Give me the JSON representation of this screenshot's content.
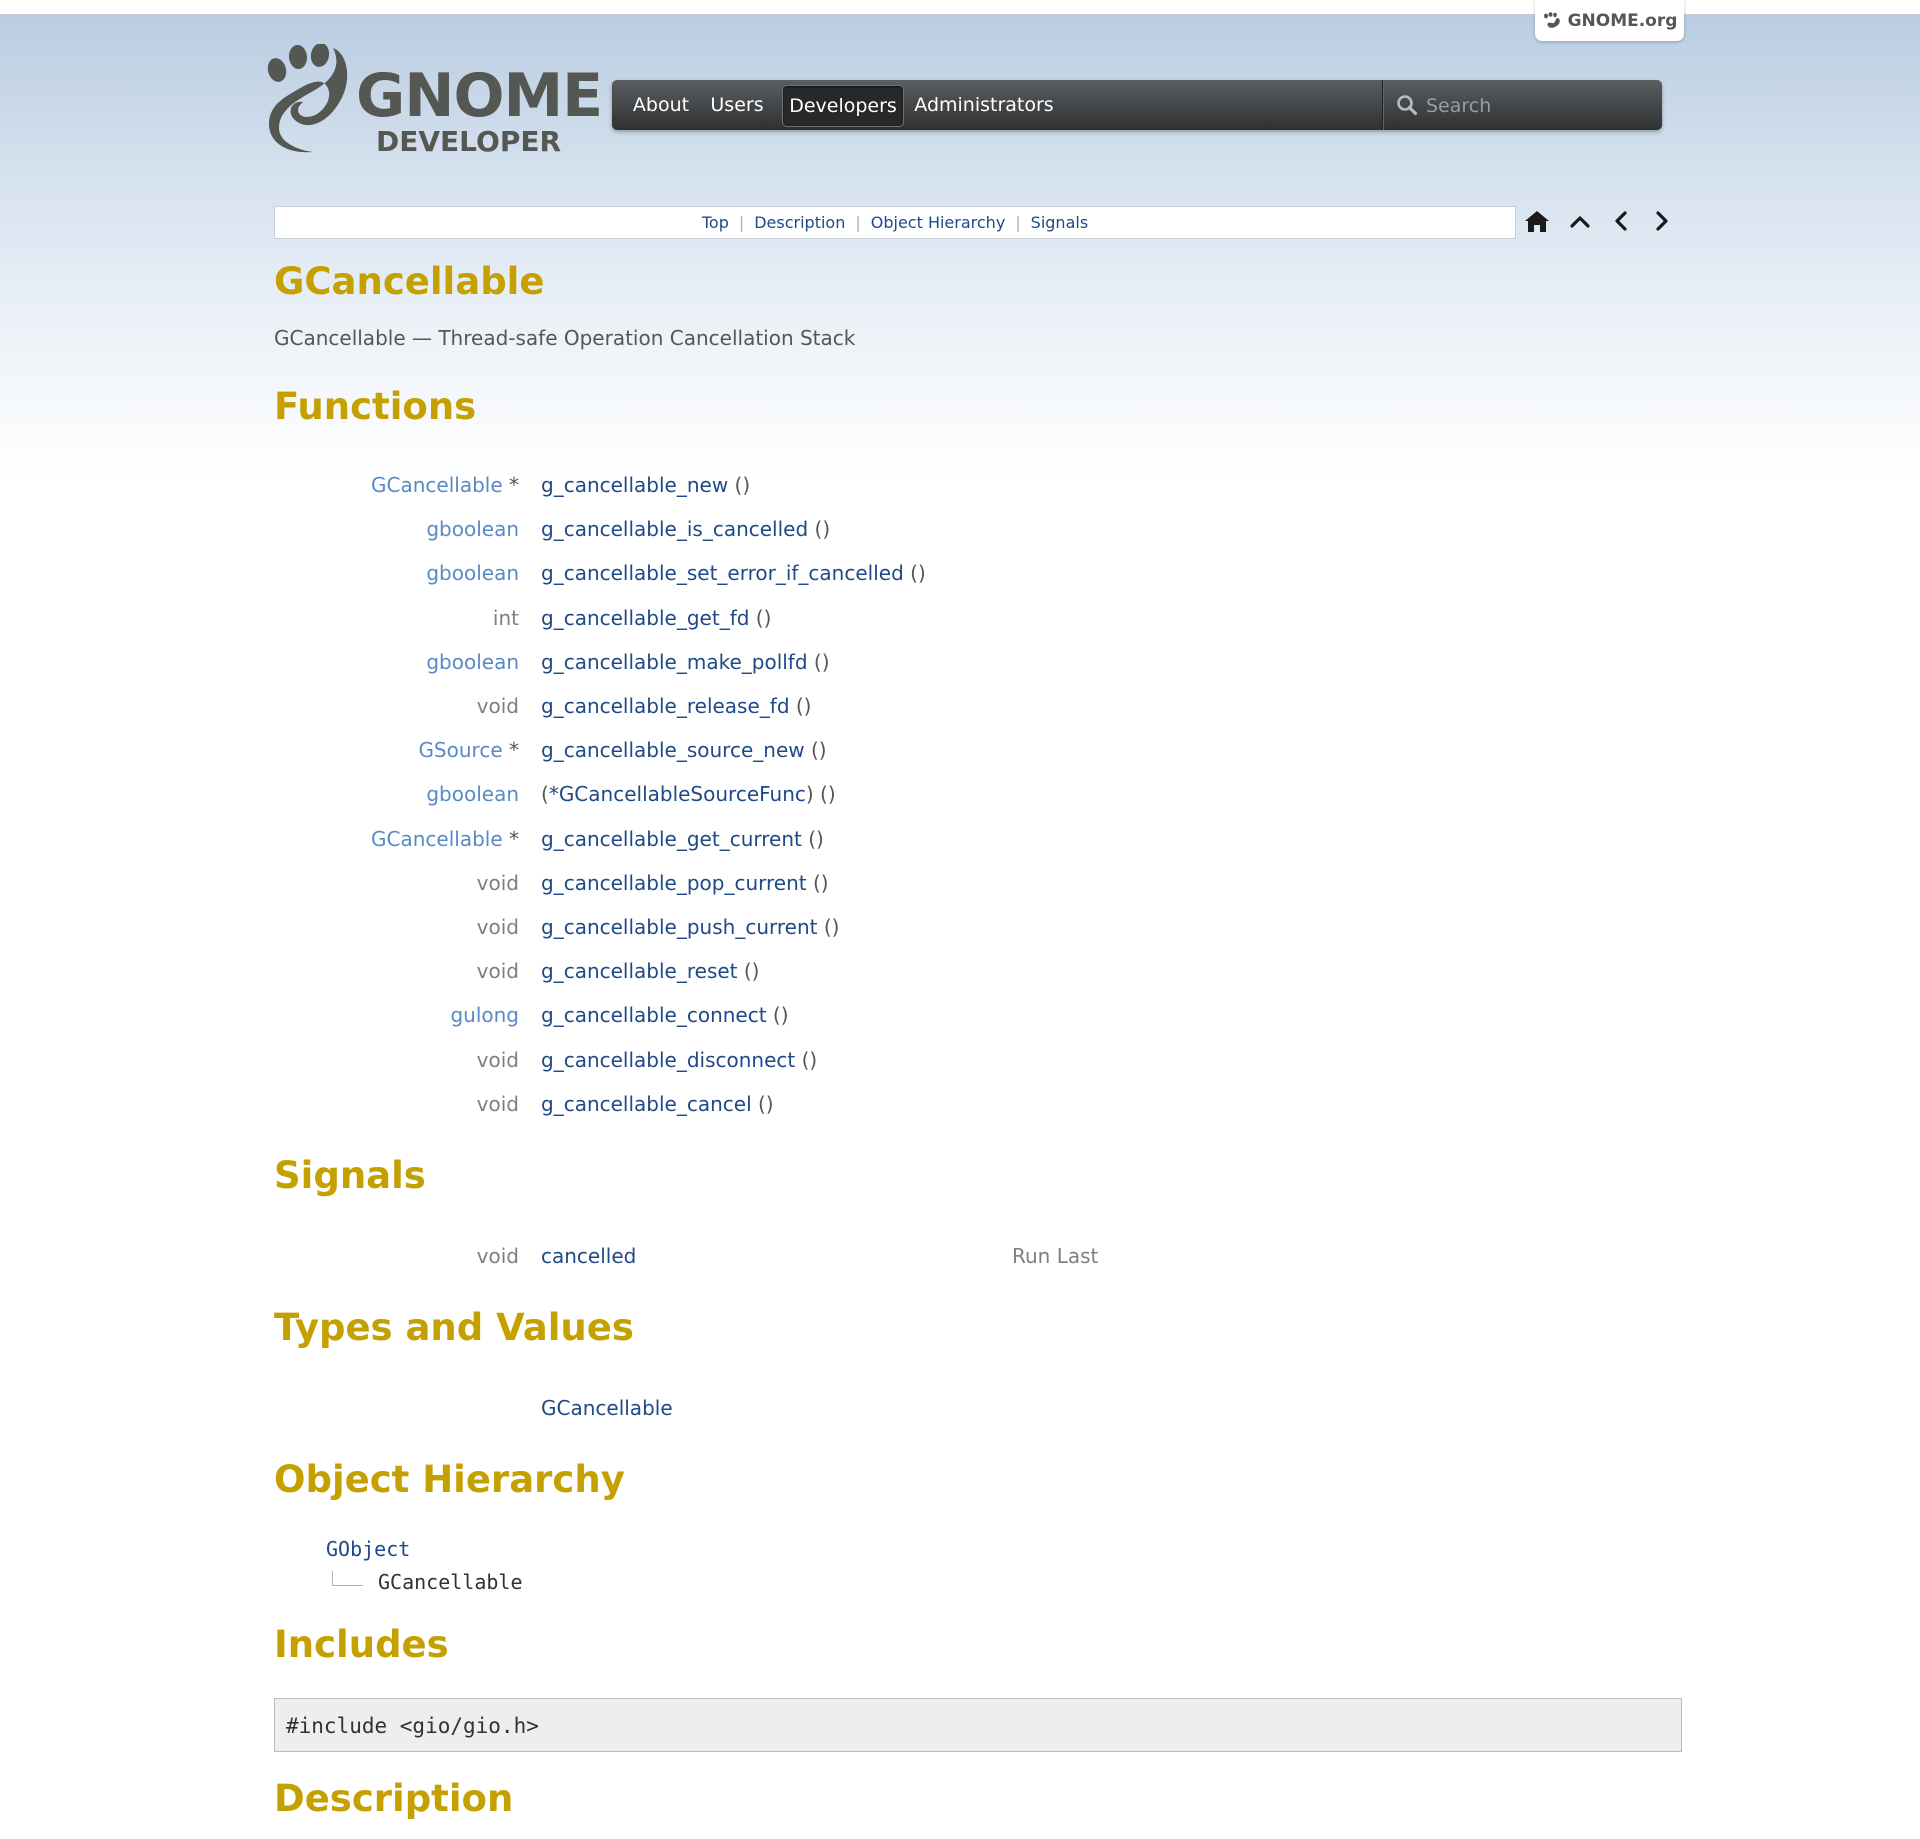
{
  "header": {
    "gnome_org_label": "GNOME.org",
    "logo_top": "GNOME",
    "logo_bottom": "DEVELOPER",
    "nav": [
      {
        "label": "About",
        "active": false
      },
      {
        "label": "Users",
        "active": false
      },
      {
        "label": "Developers",
        "active": true
      },
      {
        "label": "Administrators",
        "active": false
      }
    ],
    "search_placeholder": "Search"
  },
  "docnav": {
    "links": [
      "Top",
      "Description",
      "Object Hierarchy",
      "Signals"
    ],
    "separator": "|",
    "icons": [
      "home-icon",
      "up-icon",
      "prev-icon",
      "next-icon"
    ]
  },
  "page": {
    "title": "GCancellable",
    "subtitle": "GCancellable — Thread-safe Operation Cancellation Stack"
  },
  "functions": {
    "heading": "Functions",
    "rows": [
      {
        "ret": "GCancellable",
        "ret_linked": true,
        "ptr": " *",
        "name": "g_cancellable_new",
        "args": " ()"
      },
      {
        "ret": "gboolean",
        "ret_linked": true,
        "ptr": "",
        "name": "g_cancellable_is_cancelled",
        "args": " ()"
      },
      {
        "ret": "gboolean",
        "ret_linked": true,
        "ptr": "",
        "name": "g_cancellable_set_error_if_cancelled",
        "args": " ()"
      },
      {
        "ret": "int",
        "ret_linked": false,
        "ptr": "",
        "name": "g_cancellable_get_fd",
        "args": " ()"
      },
      {
        "ret": "gboolean",
        "ret_linked": true,
        "ptr": "",
        "name": "g_cancellable_make_pollfd",
        "args": " ()"
      },
      {
        "ret": "void",
        "ret_linked": false,
        "ptr": "",
        "name": "g_cancellable_release_fd",
        "args": " ()"
      },
      {
        "ret": "GSource",
        "ret_linked": true,
        "ptr": " *",
        "name": "g_cancellable_source_new",
        "args": " ()"
      },
      {
        "ret": "gboolean",
        "ret_linked": true,
        "ptr": "",
        "prefix": "(",
        "name": "*GCancellableSourceFunc",
        "suffix": ")",
        "args": " ()"
      },
      {
        "ret": "GCancellable",
        "ret_linked": true,
        "ptr": " *",
        "name": "g_cancellable_get_current",
        "args": " ()"
      },
      {
        "ret": "void",
        "ret_linked": false,
        "ptr": "",
        "name": "g_cancellable_pop_current",
        "args": " ()"
      },
      {
        "ret": "void",
        "ret_linked": false,
        "ptr": "",
        "name": "g_cancellable_push_current",
        "args": " ()"
      },
      {
        "ret": "void",
        "ret_linked": false,
        "ptr": "",
        "name": "g_cancellable_reset",
        "args": " ()"
      },
      {
        "ret": "gulong",
        "ret_linked": true,
        "ptr": "",
        "name": "g_cancellable_connect",
        "args": " ()"
      },
      {
        "ret": "void",
        "ret_linked": false,
        "ptr": "",
        "name": "g_cancellable_disconnect",
        "args": " ()"
      },
      {
        "ret": "void",
        "ret_linked": false,
        "ptr": "",
        "name": "g_cancellable_cancel",
        "args": " ()"
      }
    ]
  },
  "signals": {
    "heading": "Signals",
    "rows": [
      {
        "ret": "void",
        "name": "cancelled",
        "flags": "Run Last"
      }
    ]
  },
  "types": {
    "heading": "Types and Values",
    "items": [
      "GCancellable"
    ]
  },
  "hierarchy": {
    "heading": "Object Hierarchy",
    "parent": "GObject",
    "child": "GCancellable"
  },
  "includes": {
    "heading": "Includes",
    "code": "#include <gio/gio.h>"
  },
  "description": {
    "heading": "Description"
  },
  "colors": {
    "heading": "#c4a000",
    "link": "#204a87",
    "type_link": "#5a8ac6",
    "muted": "#7d8083"
  }
}
